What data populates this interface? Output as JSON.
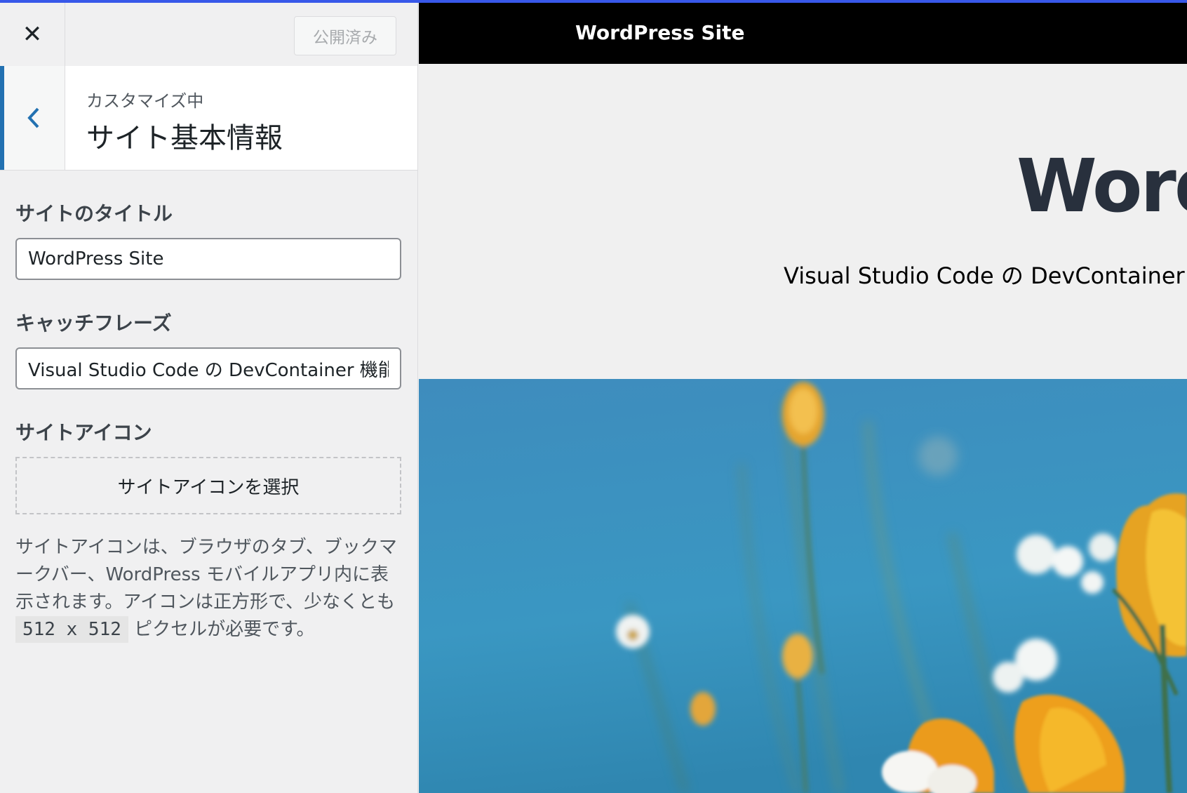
{
  "header": {
    "close_icon": "close-icon",
    "publish_label": "公開済み"
  },
  "section": {
    "back_icon": "chevron-left-icon",
    "customizing_label": "カスタマイズ中",
    "title": "サイト基本情報"
  },
  "controls": {
    "site_title_label": "サイトのタイトル",
    "site_title_value": "WordPress Site",
    "tagline_label": "キャッチフレーズ",
    "tagline_value": "Visual Studio Code の DevContainer 機能",
    "site_icon_label": "サイトアイコン",
    "site_icon_button": "サイトアイコンを選択",
    "site_icon_desc_before": "サイトアイコンは、ブラウザのタブ、ブックマークバー、WordPress モバイルアプリ内に表示されます。アイコンは正方形で、少なくとも ",
    "site_icon_desc_code": "512 x 512",
    "site_icon_desc_after": " ピクセルが必要です。"
  },
  "preview": {
    "top_bar_title": "WordPress Site",
    "site_title": "WordPress Site",
    "tagline": "Visual Studio Code の DevContainer 機能"
  },
  "colors": {
    "accent": "#2271b1",
    "topline": "#3858e9",
    "preview_bar": "#000000"
  }
}
